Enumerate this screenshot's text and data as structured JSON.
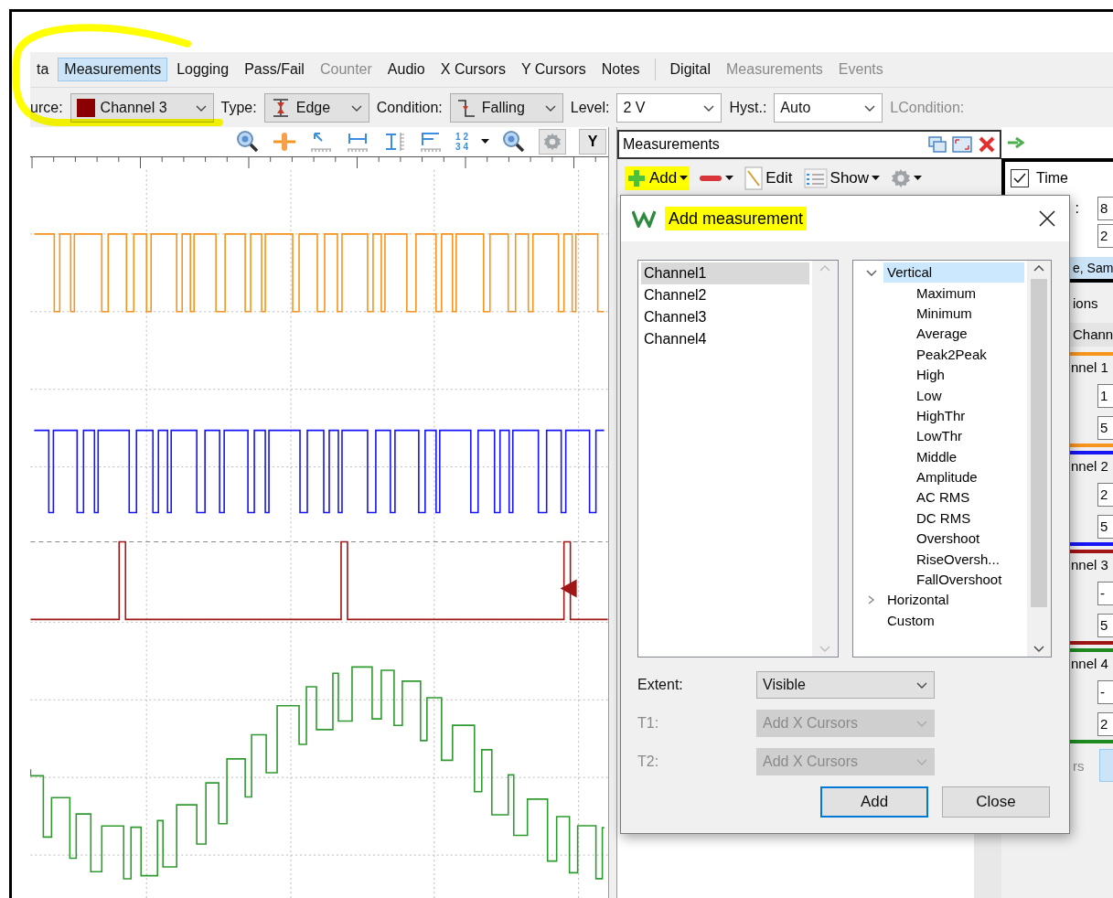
{
  "highlight_loop": true,
  "tab_groups": [
    {
      "tabs": [
        {
          "label": "ta",
          "selected": false,
          "disabled": false
        },
        {
          "label": "Measurements",
          "selected": true,
          "disabled": false
        },
        {
          "label": "Logging",
          "selected": false,
          "disabled": false
        },
        {
          "label": "Pass/Fail",
          "selected": false,
          "disabled": false
        },
        {
          "label": "Counter",
          "selected": false,
          "disabled": true
        },
        {
          "label": "Audio",
          "selected": false,
          "disabled": false
        },
        {
          "label": "X Cursors",
          "selected": false,
          "disabled": false
        },
        {
          "label": "Y Cursors",
          "selected": false,
          "disabled": false
        },
        {
          "label": "Notes",
          "selected": false,
          "disabled": false
        }
      ]
    },
    {
      "tabs": [
        {
          "label": "Digital",
          "selected": false,
          "disabled": false
        },
        {
          "label": "Measurements",
          "selected": false,
          "disabled": true
        },
        {
          "label": "Events",
          "selected": false,
          "disabled": true
        }
      ]
    }
  ],
  "trigger_bar": [
    {
      "kind": "label",
      "text": "urce:",
      "disabled": false
    },
    {
      "kind": "select",
      "value": "Channel 3",
      "color": "#8b0000",
      "editable": false
    },
    {
      "kind": "label",
      "text": "Type:",
      "disabled": false
    },
    {
      "kind": "select",
      "value": "Edge",
      "editable": false
    },
    {
      "kind": "label",
      "text": "Condition:",
      "disabled": false
    },
    {
      "kind": "select",
      "value": "Falling",
      "editable": false
    },
    {
      "kind": "label",
      "text": "Level:",
      "disabled": false
    },
    {
      "kind": "select",
      "value": "2 V",
      "editable": true
    },
    {
      "kind": "label",
      "text": "Hyst.:",
      "disabled": false
    },
    {
      "kind": "select",
      "value": "Auto",
      "editable": true
    },
    {
      "kind": "label",
      "text": "LCondition:",
      "disabled": true
    }
  ],
  "scope": {
    "toolbar": {
      "numbers": [
        "1 2",
        "3 4"
      ],
      "y_button": "Y"
    },
    "traces": [
      {
        "kind": "square",
        "color": "#f7941d"
      },
      {
        "kind": "square",
        "color": "#1515f5"
      },
      {
        "kind": "pulse",
        "color": "#a01515"
      },
      {
        "kind": "steps",
        "color": "#2f9a2f"
      }
    ]
  },
  "measurements_panel": {
    "title": "Measurements",
    "toolbar": [
      {
        "label": "Add",
        "dropdown": true,
        "highlighted": true
      },
      {
        "dropdown": true,
        "highlighted": false
      },
      {
        "label": "Edit",
        "dropdown": false,
        "highlighted": false
      },
      {
        "label": "Show",
        "dropdown": true,
        "highlighted": false
      },
      {
        "dropdown": true,
        "highlighted": false
      }
    ]
  },
  "dialog": {
    "title": "Add measurement",
    "title_highlighted": true,
    "sources": [
      {
        "label": "Channel1",
        "selected": true
      },
      {
        "label": "Channel2",
        "selected": false
      },
      {
        "label": "Channel3",
        "selected": false
      },
      {
        "label": "Channel4",
        "selected": false
      }
    ],
    "tree": [
      {
        "label": "Vertical",
        "expanded": true,
        "selected": true,
        "children": [
          {
            "label": "Maximum",
            "selected": false
          },
          {
            "label": "Minimum",
            "selected": false
          },
          {
            "label": "Average",
            "selected": false
          },
          {
            "label": "Peak2Peak",
            "selected": false
          },
          {
            "label": "High",
            "selected": false
          },
          {
            "label": "Low",
            "selected": false
          },
          {
            "label": "HighThr",
            "selected": false
          },
          {
            "label": "LowThr",
            "selected": false
          },
          {
            "label": "Middle",
            "selected": false
          },
          {
            "label": "Amplitude",
            "selected": false
          },
          {
            "label": "AC RMS",
            "selected": false
          },
          {
            "label": "DC RMS",
            "selected": false
          },
          {
            "label": "Overshoot",
            "selected": false
          },
          {
            "label": "RiseOversh...",
            "selected": false
          },
          {
            "label": "FallOvershoot",
            "selected": false
          }
        ]
      },
      {
        "label": "Horizontal",
        "expanded": false,
        "selected": false
      },
      {
        "label": "Custom",
        "selected": false
      }
    ],
    "fields": [
      {
        "label": "Extent:",
        "value": "Visible",
        "disabled": false
      },
      {
        "label": "T1:",
        "value": "Add X Cursors",
        "disabled": true
      },
      {
        "label": "T2:",
        "value": "Add X Cursors",
        "disabled": true
      }
    ],
    "buttons": [
      {
        "label": "Add",
        "default": true
      },
      {
        "label": "Close",
        "default": false
      }
    ]
  },
  "right_panel": {
    "time": {
      "label": "Time",
      "checked": true
    },
    "time_fields": [
      {
        "label": ":",
        "value": "8"
      },
      {
        "value": "2"
      }
    ],
    "band": "e, Sam",
    "section": "ions",
    "tab": "Chann",
    "channels": [
      {
        "label": "nnel 1",
        "color": "#f7941d",
        "fields": [
          "1",
          "5"
        ]
      },
      {
        "label": "nnel 2",
        "color": "#1515f5",
        "fields": [
          "2",
          "5"
        ]
      },
      {
        "label": "nnel 3",
        "color": "#a01515",
        "fields": [
          "-",
          "5"
        ]
      },
      {
        "label": "nnel 4",
        "color": "#1f8a1f",
        "fields": [
          "-",
          "2"
        ]
      }
    ],
    "footer": "rs"
  }
}
